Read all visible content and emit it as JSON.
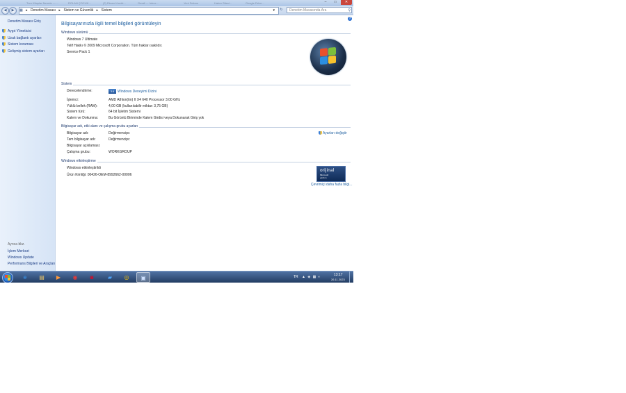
{
  "ghost_tabs": [
    "Tum Kitaplar Nerede — ...",
    "ROLAN ÇOCUK...",
    "(2) Eksen Komik...",
    "Gmail — Inbox...",
    "Yeni Sekme",
    "Haber Sitesi...",
    "Google Drive..."
  ],
  "window_controls": {
    "minimize": "–",
    "maximize": "□",
    "close": "✕"
  },
  "address_bar": {
    "crumbs": [
      "Denetim Masası",
      "Sistem ve Güvenlik",
      "Sistem"
    ],
    "separator": "▸",
    "search_placeholder": "Denetim Masasında Ara"
  },
  "left_pane": {
    "home": "Denetim Masası Giriş",
    "items": [
      "Aygıt Yöneticisi",
      "Uzak bağlantı ayarları",
      "Sistem koruması",
      "Gelişmiş sistem ayarları"
    ],
    "see_also": "Ayrıca bkz.",
    "see_also_links": [
      "İşlem Merkezi",
      "Windows Update",
      "Performans Bilgileri ve Araçları"
    ]
  },
  "main": {
    "title": "Bilgisayarınızla ilgili temel bilgileri görüntüleyin",
    "edition": {
      "header": "Windows sürümü",
      "name": "Windows 7 Ultimate",
      "copyright": "Telif Hakkı © 2009 Microsoft Corporation. Tüm hakları saklıdır.",
      "service_pack": "Service Pack 1"
    },
    "system": {
      "header": "Sistem",
      "rating_label": "Derecelendirme:",
      "rating_badge": "3.6",
      "rating_link": "Windows Deneyimi Dizini",
      "rows": [
        {
          "key": "İşlemci:",
          "value": "AMD Athlon(tm) II X4 640 Processor   3.00 GHz"
        },
        {
          "key": "Yüklü bellek (RAM):",
          "value": "4,00 GB (kullanılabilir miktar: 3,75 GB)"
        },
        {
          "key": "Sistem türü:",
          "value": "64 bit İşletim Sistemi"
        },
        {
          "key": "Kalem ve Dokunma:",
          "value": "Bu Görüntü Biriminde Kalem Girdisi veya Dokunarak Giriş yok"
        }
      ]
    },
    "computer": {
      "header": "Bilgisayar adı, etki alanı ve çalışma grubu ayarları",
      "change_link": "Ayarları değiştir",
      "rows": [
        {
          "key": "Bilgisayar adı:",
          "value": "Değirmencipc"
        },
        {
          "key": "Tam bilgisayar adı:",
          "value": "Değirmencipc"
        },
        {
          "key": "Bilgisayar açıklaması:",
          "value": ""
        },
        {
          "key": "Çalışma grubu:",
          "value": "WORKGROUP"
        }
      ]
    },
    "activation": {
      "header": "Windows etkinleştirme",
      "status": "Windows etkinleştirildi",
      "product_id": "Ürün Kimliği: 00426-OEM-8992662-00006",
      "genuine_line1": "orijinal",
      "genuine_line2": "Microsoft",
      "genuine_line3": "yazılım",
      "more_link": "Çevrimiçi daha fazla bilgi..."
    }
  },
  "taskbar": {
    "apps": [
      {
        "icon": "internet-explorer-icon",
        "glyph": "e",
        "color": "#3aa0ff"
      },
      {
        "icon": "file-explorer-icon",
        "glyph": "▤",
        "color": "#e9c46a"
      },
      {
        "icon": "media-player-icon",
        "glyph": "▶",
        "color": "#ff9a3c"
      },
      {
        "icon": "app-red-icon",
        "glyph": "◉",
        "color": "#e23b3b"
      },
      {
        "icon": "app-dark-red-icon",
        "glyph": "◙",
        "color": "#c8102e"
      },
      {
        "icon": "folder-icon",
        "glyph": "▰",
        "color": "#4fa3f7"
      },
      {
        "icon": "chrome-icon",
        "glyph": "◎",
        "color": "#f4c20d"
      },
      {
        "icon": "system-window-icon",
        "glyph": "▣",
        "color": "#cfe2ff"
      }
    ],
    "lang": "TR",
    "tray_icons": "▲ ◈ ▦ ◐",
    "time": "13:17",
    "date": "26.11.2023"
  }
}
